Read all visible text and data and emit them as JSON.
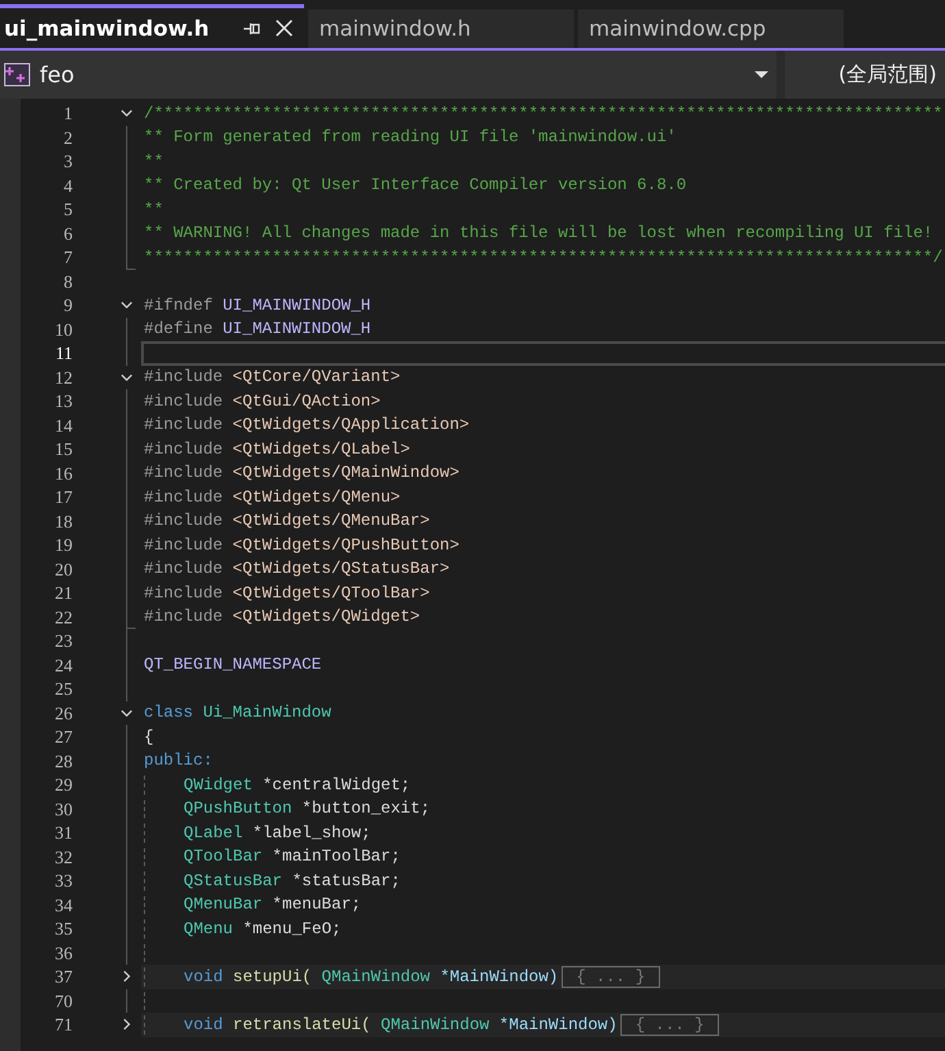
{
  "tabs": [
    {
      "label": "ui_mainwindow.h",
      "selected": true
    },
    {
      "label": "mainwindow.h",
      "selected": false
    },
    {
      "label": "mainwindow.cpp",
      "selected": false
    }
  ],
  "navigation": {
    "member": "feo",
    "scope": "(全局范围)"
  },
  "lines": [
    {
      "num": "1",
      "kind": "fold-open",
      "tokens": [
        {
          "kind": "comment",
          "text": "/********************************************************************************"
        }
      ]
    },
    {
      "num": "2",
      "kind": "guide",
      "tokens": [
        {
          "kind": "comment",
          "text": "** Form generated from reading UI file 'mainwindow.ui'"
        }
      ]
    },
    {
      "num": "3",
      "kind": "guide",
      "tokens": [
        {
          "kind": "comment",
          "text": "**"
        }
      ]
    },
    {
      "num": "4",
      "kind": "guide",
      "tokens": [
        {
          "kind": "comment",
          "text": "** Created by: Qt User Interface Compiler version 6.8.0"
        }
      ]
    },
    {
      "num": "5",
      "kind": "guide",
      "tokens": [
        {
          "kind": "comment",
          "text": "**"
        }
      ]
    },
    {
      "num": "6",
      "kind": "guide",
      "tokens": [
        {
          "kind": "comment",
          "text": "** WARNING! All changes made in this file will be lost when recompiling UI file!"
        }
      ]
    },
    {
      "num": "7",
      "kind": "guide-end",
      "tokens": [
        {
          "kind": "comment",
          "text": "********************************************************************************/"
        }
      ]
    },
    {
      "num": "8",
      "kind": "plain"
    },
    {
      "num": "9",
      "kind": "fold-open",
      "tokens": [
        {
          "kind": "preproc",
          "text": "#ifndef"
        },
        {
          "kind": "macro",
          "text": "UI_MAINWINDOW_H"
        }
      ]
    },
    {
      "num": "10",
      "kind": "guide",
      "tokens": [
        {
          "kind": "preproc",
          "text": "#define"
        },
        {
          "kind": "macro",
          "text": "UI_MAINWINDOW_H"
        }
      ]
    },
    {
      "num": "11",
      "kind": "guide",
      "current": true
    },
    {
      "num": "12",
      "kind": "fold-open",
      "tokens": [
        {
          "kind": "preproc",
          "text": "#include"
        },
        {
          "kind": "path",
          "text": "<QtCore/QVariant>"
        }
      ]
    },
    {
      "num": "13",
      "kind": "guide",
      "tokens": [
        {
          "kind": "preproc",
          "text": "#include"
        },
        {
          "kind": "path",
          "text": "<QtGui/QAction>"
        }
      ]
    },
    {
      "num": "14",
      "kind": "guide",
      "tokens": [
        {
          "kind": "preproc",
          "text": "#include"
        },
        {
          "kind": "path",
          "text": "<QtWidgets/QApplication>"
        }
      ]
    },
    {
      "num": "15",
      "kind": "guide",
      "tokens": [
        {
          "kind": "preproc",
          "text": "#include"
        },
        {
          "kind": "path",
          "text": "<QtWidgets/QLabel>"
        }
      ]
    },
    {
      "num": "16",
      "kind": "guide",
      "tokens": [
        {
          "kind": "preproc",
          "text": "#include"
        },
        {
          "kind": "path",
          "text": "<QtWidgets/QMainWindow>"
        }
      ]
    },
    {
      "num": "17",
      "kind": "guide",
      "tokens": [
        {
          "kind": "preproc",
          "text": "#include"
        },
        {
          "kind": "path",
          "text": "<QtWidgets/QMenu>"
        }
      ]
    },
    {
      "num": "18",
      "kind": "guide",
      "tokens": [
        {
          "kind": "preproc",
          "text": "#include"
        },
        {
          "kind": "path",
          "text": "<QtWidgets/QMenuBar>"
        }
      ]
    },
    {
      "num": "19",
      "kind": "guide",
      "tokens": [
        {
          "kind": "preproc",
          "text": "#include"
        },
        {
          "kind": "path",
          "text": "<QtWidgets/QPushButton>"
        }
      ]
    },
    {
      "num": "20",
      "kind": "guide",
      "tokens": [
        {
          "kind": "preproc",
          "text": "#include"
        },
        {
          "kind": "path",
          "text": "<QtWidgets/QStatusBar>"
        }
      ]
    },
    {
      "num": "21",
      "kind": "guide",
      "tokens": [
        {
          "kind": "preproc",
          "text": "#include"
        },
        {
          "kind": "path",
          "text": "<QtWidgets/QToolBar>"
        }
      ]
    },
    {
      "num": "22",
      "kind": "guide-end",
      "tokens": [
        {
          "kind": "preproc",
          "text": "#include"
        },
        {
          "kind": "path",
          "text": "<QtWidgets/QWidget>"
        }
      ]
    },
    {
      "num": "23",
      "kind": "guide"
    },
    {
      "num": "24",
      "kind": "guide",
      "tokens": [
        {
          "kind": "macro",
          "text": "QT_BEGIN_NAMESPACE"
        }
      ]
    },
    {
      "num": "25",
      "kind": "guide"
    },
    {
      "num": "26",
      "kind": "fold-open",
      "tokens": [
        {
          "kind": "keyword",
          "text": "class"
        },
        {
          "kind": "type",
          "text": "Ui_MainWindow"
        }
      ]
    },
    {
      "num": "27",
      "kind": "guide",
      "tokens": [
        {
          "kind": "plain",
          "text": "{"
        }
      ]
    },
    {
      "num": "28",
      "kind": "guide",
      "tokens": [
        {
          "kind": "keyword",
          "text": "public:"
        }
      ]
    },
    {
      "num": "29",
      "kind": "guide",
      "indented": true,
      "tokens": [
        {
          "kind": "type",
          "text": "QWidget"
        },
        {
          "kind": "plain",
          "text": "*centralWidget;"
        }
      ]
    },
    {
      "num": "30",
      "kind": "guide",
      "indented": true,
      "tokens": [
        {
          "kind": "type",
          "text": "QPushButton"
        },
        {
          "kind": "plain",
          "text": "*button_exit;"
        }
      ]
    },
    {
      "num": "31",
      "kind": "guide",
      "indented": true,
      "tokens": [
        {
          "kind": "type",
          "text": "QLabel"
        },
        {
          "kind": "plain",
          "text": "*label_show;"
        }
      ]
    },
    {
      "num": "32",
      "kind": "guide",
      "indented": true,
      "tokens": [
        {
          "kind": "type",
          "text": "QToolBar"
        },
        {
          "kind": "plain",
          "text": "*mainToolBar;"
        }
      ]
    },
    {
      "num": "33",
      "kind": "guide",
      "indented": true,
      "tokens": [
        {
          "kind": "type",
          "text": "QStatusBar"
        },
        {
          "kind": "plain",
          "text": "*statusBar;"
        }
      ]
    },
    {
      "num": "34",
      "kind": "guide",
      "indented": true,
      "tokens": [
        {
          "kind": "type",
          "text": "QMenuBar"
        },
        {
          "kind": "plain",
          "text": "*menuBar;"
        }
      ]
    },
    {
      "num": "35",
      "kind": "guide",
      "indented": true,
      "tokens": [
        {
          "kind": "type",
          "text": "QMenu"
        },
        {
          "kind": "plain",
          "text": "*menu_FeO;"
        }
      ]
    },
    {
      "num": "36",
      "kind": "guide",
      "indented": true
    },
    {
      "num": "37",
      "kind": "fold-closed",
      "indented": true,
      "tokens": [
        {
          "kind": "keyword",
          "text": "void"
        },
        {
          "kind": "func",
          "text": "setupUi("
        },
        {
          "kind": "type",
          "text": "QMainWindow"
        },
        {
          "kind": "param",
          "text": "*MainWindow)"
        }
      ],
      "collapsed": "{ ... }"
    },
    {
      "num": "70",
      "kind": "guide",
      "indented": true
    },
    {
      "num": "71",
      "kind": "fold-closed",
      "indented": true,
      "tokens": [
        {
          "kind": "keyword",
          "text": "void"
        },
        {
          "kind": "func",
          "text": "retranslateUi("
        },
        {
          "kind": "type",
          "text": "QMainWindow"
        },
        {
          "kind": "param",
          "text": "*MainWindow)"
        }
      ],
      "collapsed": "{ ... }"
    }
  ]
}
